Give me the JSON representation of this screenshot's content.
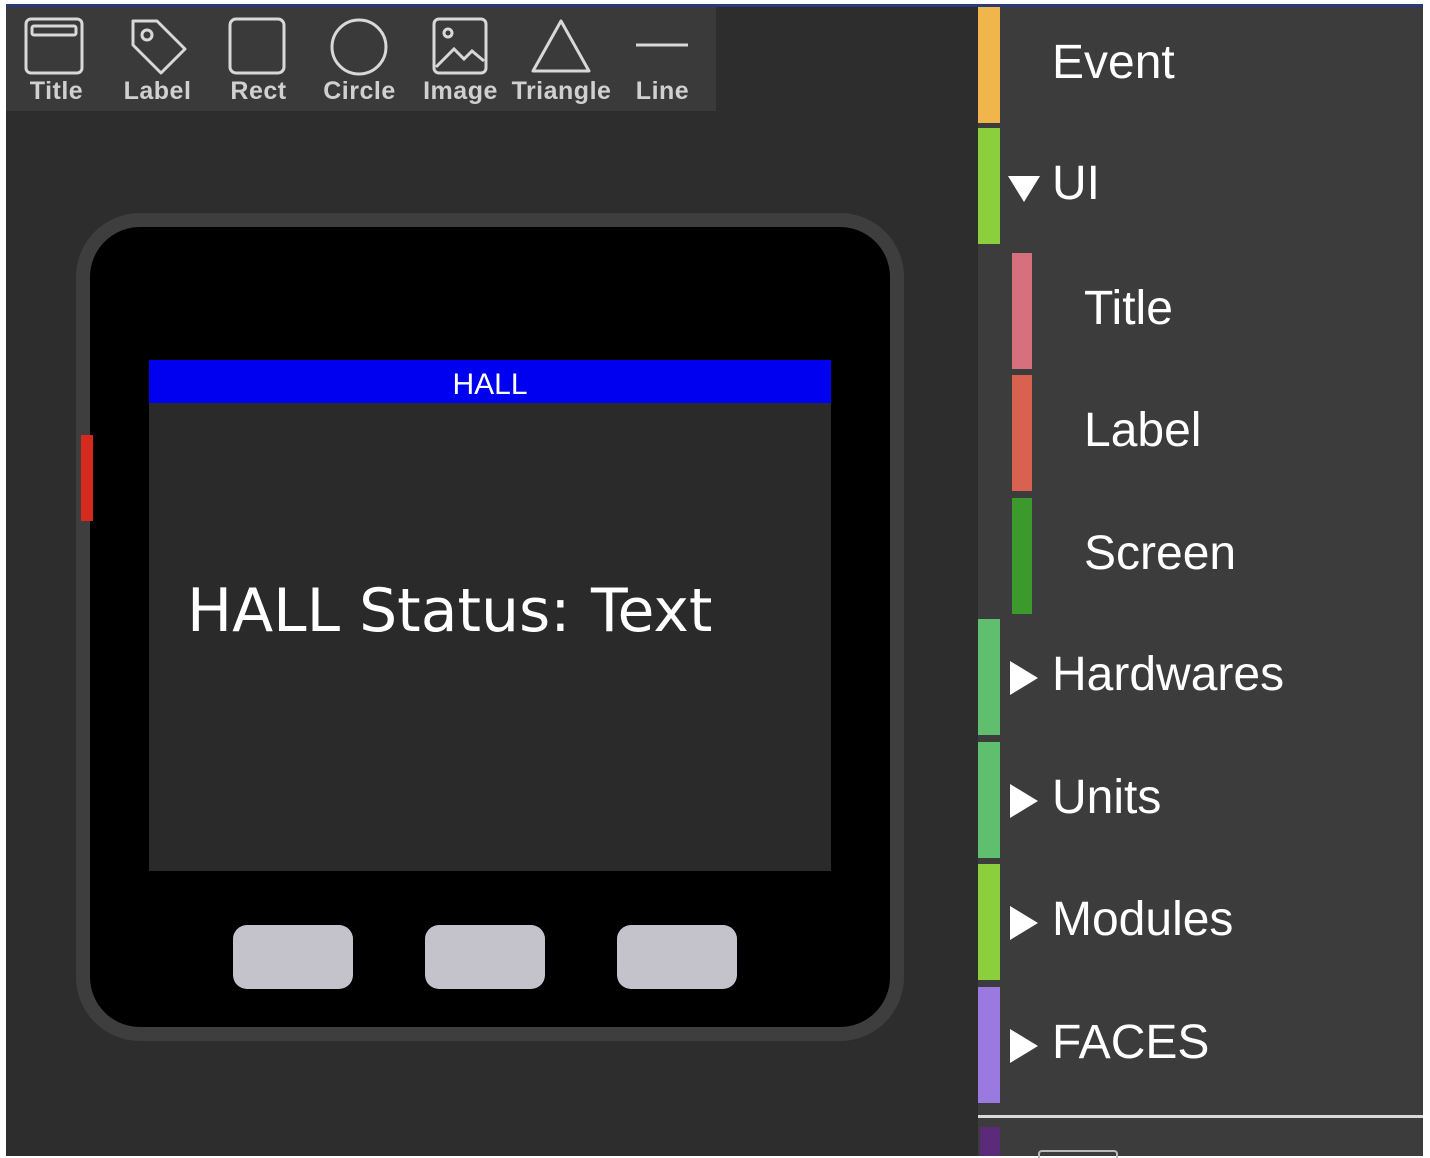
{
  "toolbar": {
    "items": [
      {
        "label": "Title",
        "icon": "title-window-icon"
      },
      {
        "label": "Label",
        "icon": "tag-icon"
      },
      {
        "label": "Rect",
        "icon": "rectangle-icon"
      },
      {
        "label": "Circle",
        "icon": "circle-icon"
      },
      {
        "label": "Image",
        "icon": "image-icon"
      },
      {
        "label": "Triangle",
        "icon": "triangle-icon"
      },
      {
        "label": "Line",
        "icon": "line-icon"
      }
    ]
  },
  "device": {
    "title_bar": "HALL",
    "status_label": "HALL Status:",
    "status_text": "Text",
    "colors": {
      "title_bar": "#0000f0",
      "screen": "#2a2a2a",
      "side_button": "#d62a1e"
    }
  },
  "categories": {
    "event": {
      "label": "Event",
      "color": "#f0b64c"
    },
    "ui": {
      "label": "UI",
      "color": "#8ccf3c",
      "expanded": true,
      "children": [
        {
          "label": "Title",
          "color": "#d6707f"
        },
        {
          "label": "Label",
          "color": "#d9614f"
        },
        {
          "label": "Screen",
          "color": "#3c9a2c"
        }
      ]
    },
    "hardwares": {
      "label": "Hardwares",
      "color": "#5fbf6f"
    },
    "units": {
      "label": "Units",
      "color": "#5fbf6f"
    },
    "modules": {
      "label": "Modules",
      "color": "#8ccf3c"
    },
    "faces": {
      "label": "FACES",
      "color": "#9a7ae0"
    }
  }
}
